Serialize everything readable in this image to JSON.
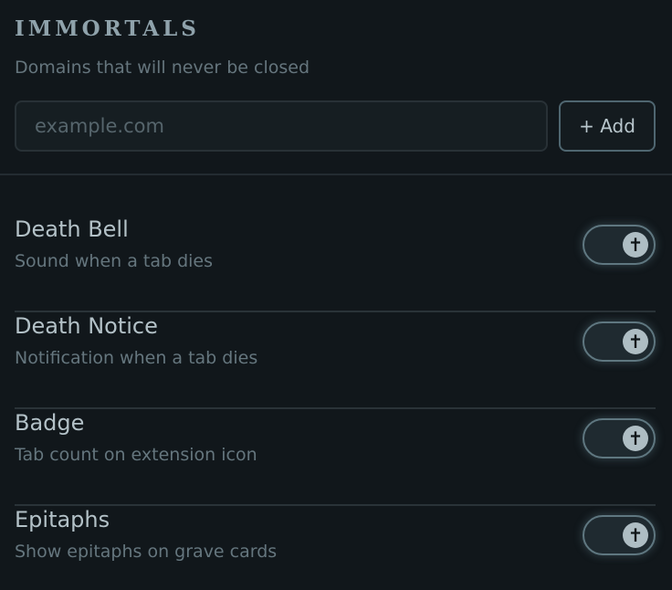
{
  "immortals": {
    "heading": "IMMORTALS",
    "description": "Domains that will never be closed",
    "input_placeholder": "example.com",
    "add_label": "+ Add"
  },
  "settings": [
    {
      "title": "Death Bell",
      "description": "Sound when a tab dies",
      "enabled": true
    },
    {
      "title": "Death Notice",
      "description": "Notification when a tab dies",
      "enabled": true
    },
    {
      "title": "Badge",
      "description": "Tab count on extension icon",
      "enabled": true
    },
    {
      "title": "Epitaphs",
      "description": "Show epitaphs on grave cards",
      "enabled": true
    }
  ],
  "toggle_icon": "✝",
  "colors": {
    "background": "#11171b",
    "accent": "#aebdc3"
  }
}
